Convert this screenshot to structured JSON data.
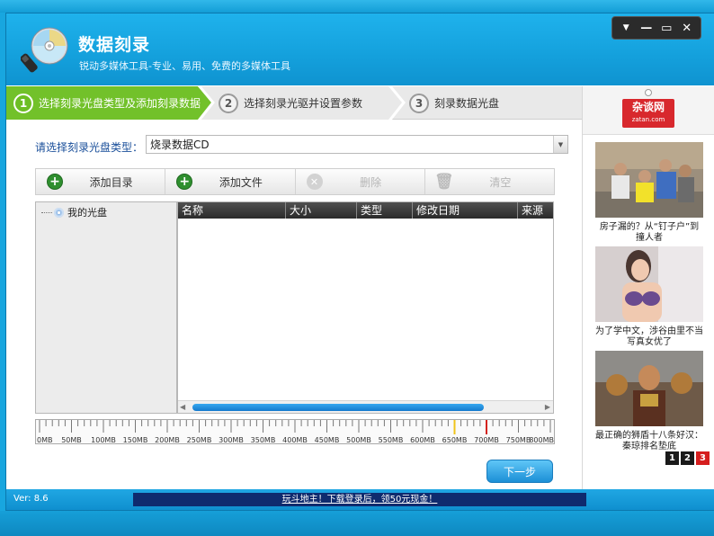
{
  "app": {
    "title": "数据刻录",
    "subtitle": "锐动多媒体工具-专业、易用、免费的多媒体工具"
  },
  "window_controls": {
    "menu": "▼",
    "minimize": "—",
    "maximize": "▭",
    "close": "✕"
  },
  "steps": [
    {
      "num": "1",
      "label": "选择刻录光盘类型及添加刻录数据",
      "active": true
    },
    {
      "num": "2",
      "label": "选择刻录光驱并设置参数",
      "active": false
    },
    {
      "num": "3",
      "label": "刻录数据光盘",
      "active": false
    }
  ],
  "disc_type": {
    "label": "请选择刻录光盘类型：",
    "value": "烧录数据CD"
  },
  "toolbar": {
    "add_folder": "添加目录",
    "add_file": "添加文件",
    "delete": "删除",
    "clear": "清空"
  },
  "tree": {
    "root": "我的光盘"
  },
  "file_list": {
    "columns": [
      "名称",
      "大小",
      "类型",
      "修改日期",
      "来源"
    ],
    "rows": []
  },
  "capacity_ruler": {
    "labels": [
      "0MB",
      "50MB",
      "100MB",
      "150MB",
      "200MB",
      "250MB",
      "300MB",
      "350MB",
      "400MB",
      "450MB",
      "500MB",
      "550MB",
      "600MB",
      "650MB",
      "700MB",
      "750MB",
      "800MB"
    ],
    "max_mb": 800,
    "yellow_marker_mb": 650,
    "red_marker_mb": 700,
    "colors": {
      "yellow": "#f0c419",
      "red": "#d4231e"
    }
  },
  "next_button": "下一步",
  "ads": {
    "logo_main": "杂谈网",
    "logo_sub": "zatan.com",
    "items": [
      {
        "caption": "房子漏的？从“钉子户”到撞人者"
      },
      {
        "caption": "为了学中文，涉谷由里不当写真女优了"
      },
      {
        "caption": "最正确的狮盾十八条好汉：秦琼排名垫底"
      }
    ],
    "pages": [
      "1",
      "2",
      "3"
    ],
    "active_page": "3"
  },
  "status": {
    "version": "Ver: 8.6",
    "marquee": "玩斗地主！下载登录后，领50元现金！"
  },
  "colors": {
    "accent": "#1fa6e3",
    "step_active": "#6dbe24",
    "list_header": "#3a3a3a"
  }
}
